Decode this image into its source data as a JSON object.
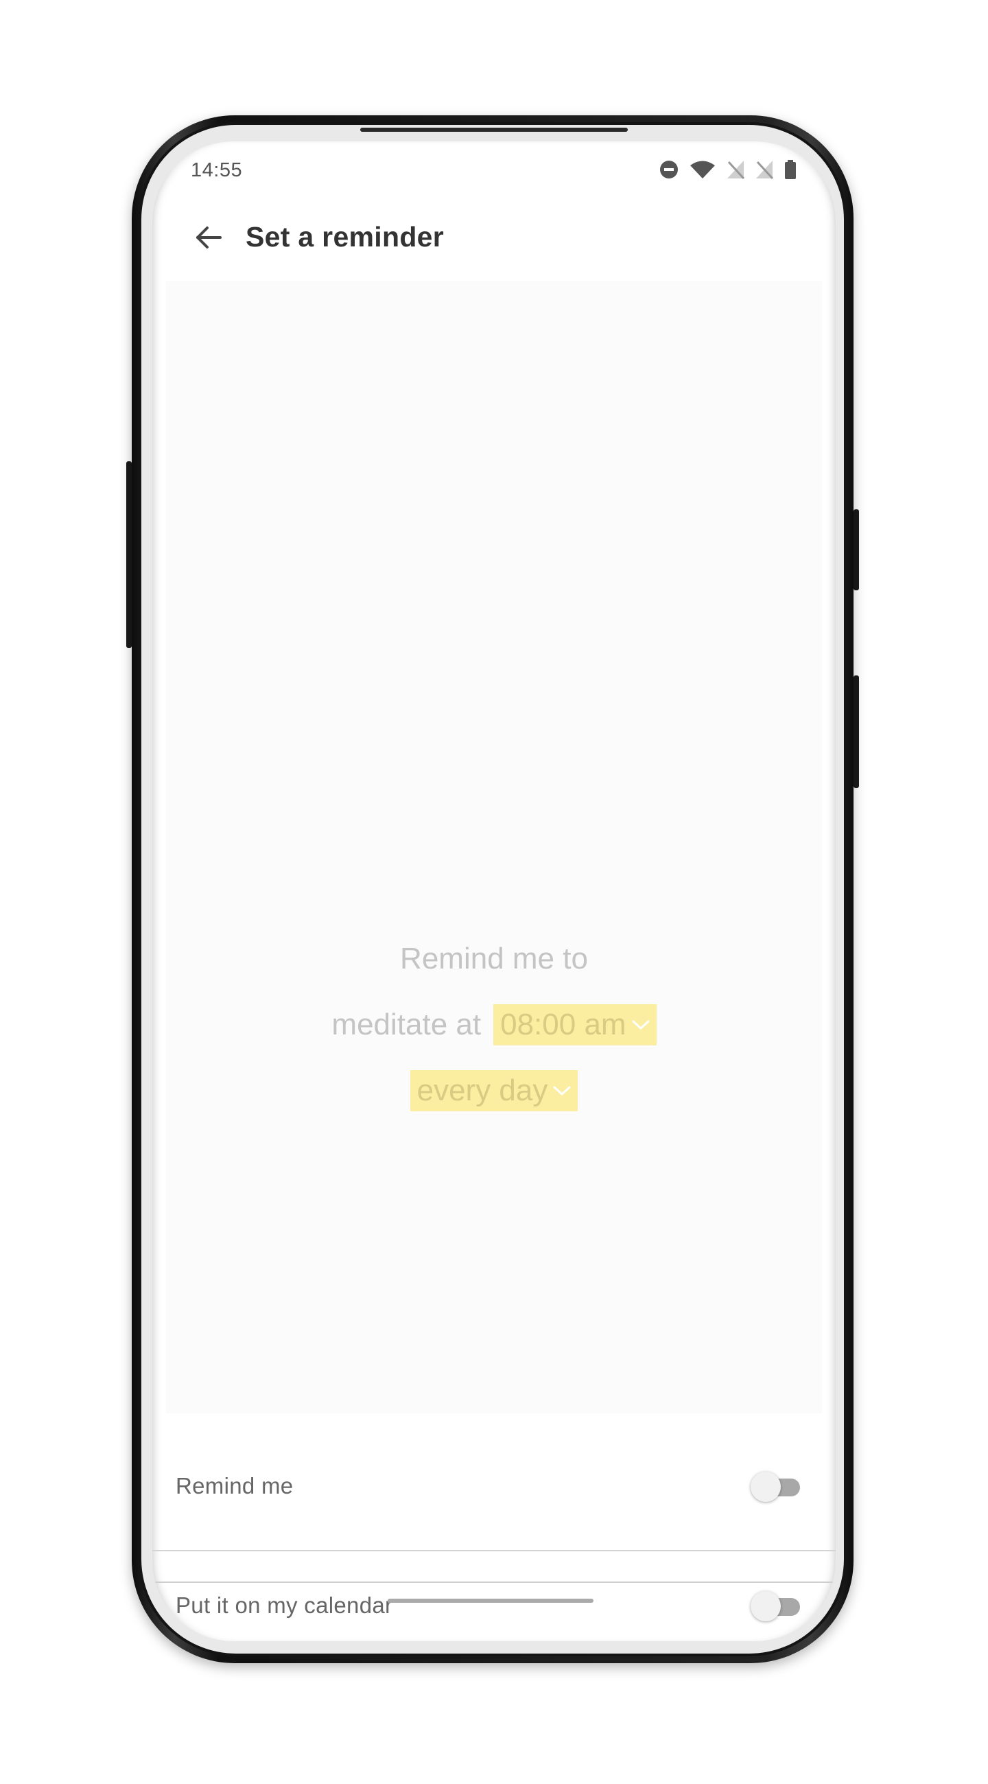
{
  "status_bar": {
    "time": "14:55",
    "icons": [
      "do-not-disturb-icon",
      "wifi-icon",
      "no-sim-icon",
      "no-sim-icon",
      "battery-icon"
    ]
  },
  "app_bar": {
    "back_icon": "arrow-left-icon",
    "title": "Set a reminder"
  },
  "reminder_sentence": {
    "line1": "Remind me to",
    "line2_text": "meditate at",
    "time_value": "08:00 am",
    "frequency_value": "every day",
    "chip_icon": "chevron-down-icon"
  },
  "settings": [
    {
      "label": "Remind me",
      "enabled": false
    },
    {
      "label": "Put it on my calendar",
      "enabled": false
    }
  ],
  "colors": {
    "chip_background": "#fbeea0",
    "chip_text": "#d8cc84",
    "muted_text": "#c4c4c4",
    "title_text": "#333333"
  }
}
